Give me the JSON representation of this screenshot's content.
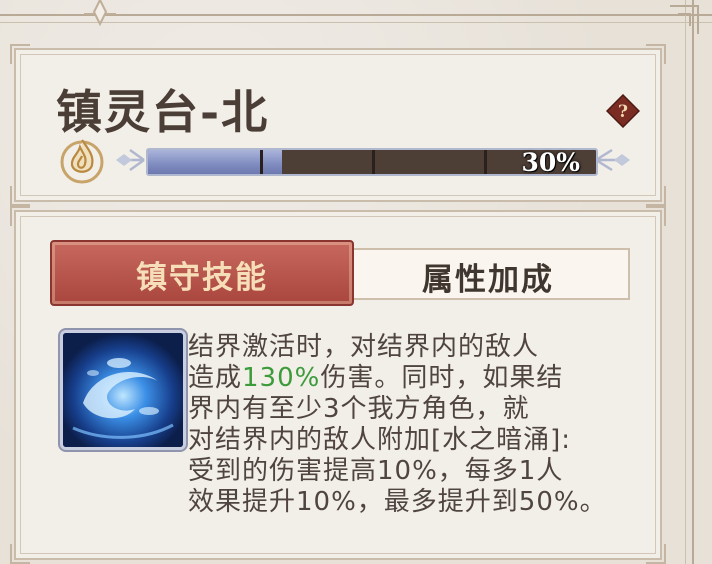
{
  "header": {
    "title": "镇灵台-北",
    "progress_label": "30%",
    "progress": 0.3,
    "help_icon": "question-icon",
    "element_icon": "hydro-flame-icon"
  },
  "tabs": [
    {
      "label": "镇守技能",
      "active": true
    },
    {
      "label": "属性加成",
      "active": false
    }
  ],
  "skill": {
    "icon": "water-vortex-icon",
    "lines": {
      "l1": "结界激活时，对结界内的敌人",
      "l2_pre": "造成",
      "l2_highlight": "130%",
      "l2_post": "伤害。同时，如果结",
      "l3": "界内有至少3个我方角色，就",
      "l4": "对结界内的敌人附加[水之暗涌]:",
      "l5": "受到的伤害提高10%，每多1人",
      "l6": "效果提升10%，最多提升到50%。"
    }
  },
  "colors": {
    "tab_active": "#b1524a",
    "highlight": "#3c9b3b",
    "text": "#4f4440",
    "progress_fill": "#8a96c8"
  }
}
